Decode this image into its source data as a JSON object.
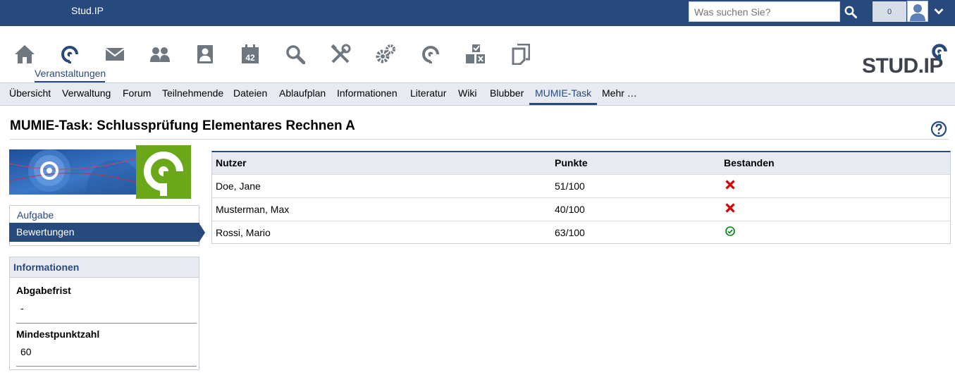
{
  "topbar": {
    "brand": "Stud.IP",
    "search_placeholder": "Was suchen Sie?",
    "notification_count": "0"
  },
  "mainnav": {
    "active_label": "Veranstaltungen",
    "icons": [
      "home-icon",
      "seminar-icon",
      "mail-icon",
      "community-icon",
      "profile-icon",
      "schedule-icon",
      "search-icon",
      "tools-icon",
      "admin-icon",
      "resources-icon",
      "courseware-icon",
      "files-icon"
    ]
  },
  "tabs": [
    "Übersicht",
    "Verwaltung",
    "Forum",
    "Teilnehmende",
    "Dateien",
    "Ablaufplan",
    "Informationen",
    "Literatur",
    "Wiki",
    "Blubber",
    "MUMIE-Task",
    "Mehr …"
  ],
  "active_tab": "MUMIE-Task",
  "page": {
    "title": "MUMIE-Task: Schlussprüfung Elementares Rechnen A"
  },
  "sidebar": {
    "nav": [
      "Aufgabe",
      "Bewertungen"
    ],
    "info_title": "Informationen",
    "info": [
      {
        "label": "Abgabefrist",
        "value": "-"
      },
      {
        "label": "Mindestpunktzahl",
        "value": "60"
      }
    ]
  },
  "table": {
    "headers": [
      "Nutzer",
      "Punkte",
      "Bestanden"
    ],
    "rows": [
      {
        "name": "Doe, Jane",
        "points": "51/100",
        "passed": false
      },
      {
        "name": "Musterman, Max",
        "points": "40/100",
        "passed": false
      },
      {
        "name": "Rossi, Mario",
        "points": "63/100",
        "passed": true
      }
    ]
  },
  "colors": {
    "primary": "#28497c",
    "fail": "#d60000",
    "pass": "#008512",
    "banner_green": "#6aa81a"
  }
}
